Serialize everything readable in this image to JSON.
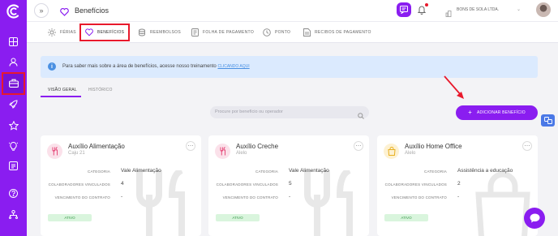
{
  "header": {
    "title": "Benefícios",
    "company": "BONS DE SOLA LTDA."
  },
  "tabs": [
    {
      "label": "FÉRIAS"
    },
    {
      "label": "BENEFÍCIOS"
    },
    {
      "label": "REEMBOLSOS"
    },
    {
      "label": "FOLHA DE PAGAMENTO"
    },
    {
      "label": "PONTO"
    },
    {
      "label": "RECIBOS DE PAGAMENTO"
    }
  ],
  "banner": {
    "text": "Para saber mais sobre a área de benefícios, acesse nosso treinamento",
    "link": "CLICANDO AQUI"
  },
  "subtabs": [
    {
      "label": "VISÃO GERAL"
    },
    {
      "label": "HISTÓRICO"
    }
  ],
  "search": {
    "placeholder": "Procure por benefício ou operador"
  },
  "add_button": {
    "label": "ADICIONAR BENEFÍCIO"
  },
  "field_labels": {
    "category": "CATEGORIA",
    "employees": "COLABORADORES VINCULADOS",
    "contract": "VENCIMENTO DO CONTRATO"
  },
  "cards": [
    {
      "title": "Auxílio Alimentação",
      "operator": "Caju 21",
      "category": "Vale Alimentação",
      "employees": "4",
      "contract": "-",
      "status": "ATIVO",
      "icon": "fork-knife-icon"
    },
    {
      "title": "Auxílio Creche",
      "operator": "Alelo",
      "category": "Vale Alimentação",
      "employees": "5",
      "contract": "-",
      "status": "ATIVO",
      "icon": "fork-knife-icon"
    },
    {
      "title": "Auxílio Home Office",
      "operator": "Alelo",
      "category": "Assistência a educação",
      "employees": "2",
      "contract": "-",
      "status": "ATIVO",
      "icon": "bag-icon"
    }
  ],
  "colors": {
    "accent": "#8a1df0",
    "highlight": "#e8192c",
    "status_active_bg": "#d9f5dd",
    "info_banner": "#dbeafe"
  }
}
